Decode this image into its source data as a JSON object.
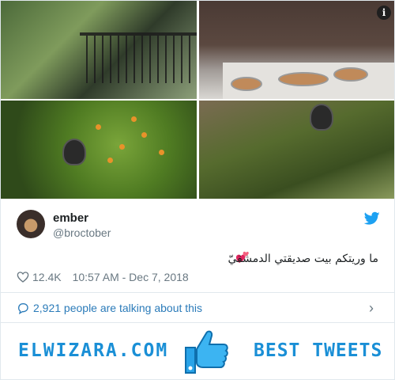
{
  "tweet": {
    "user": {
      "name": "ember",
      "handle": "@broctober"
    },
    "text": "ما وريتكم بيت صديقتي الدمشقيّ",
    "likes": "12.4K",
    "timestamp": "10:57 AM - Dec 7, 2018",
    "conversation": "2,921 people are talking about this",
    "info_label": "i"
  },
  "banner": {
    "site": "ELWIZARA.COM",
    "tagline": "BEST TWEETS"
  },
  "colors": {
    "twitter_blue": "#1da1f2",
    "link_blue": "#2b7bb9",
    "banner_blue": "#1a8fd6",
    "muted": "#697882",
    "heart_red": "#e0245e"
  },
  "icons": [
    "info-icon",
    "twitter-bird-icon",
    "heart-icon",
    "comment-icon",
    "chevron-right-icon",
    "thumbs-up-icon",
    "heart-emoji-icon"
  ]
}
